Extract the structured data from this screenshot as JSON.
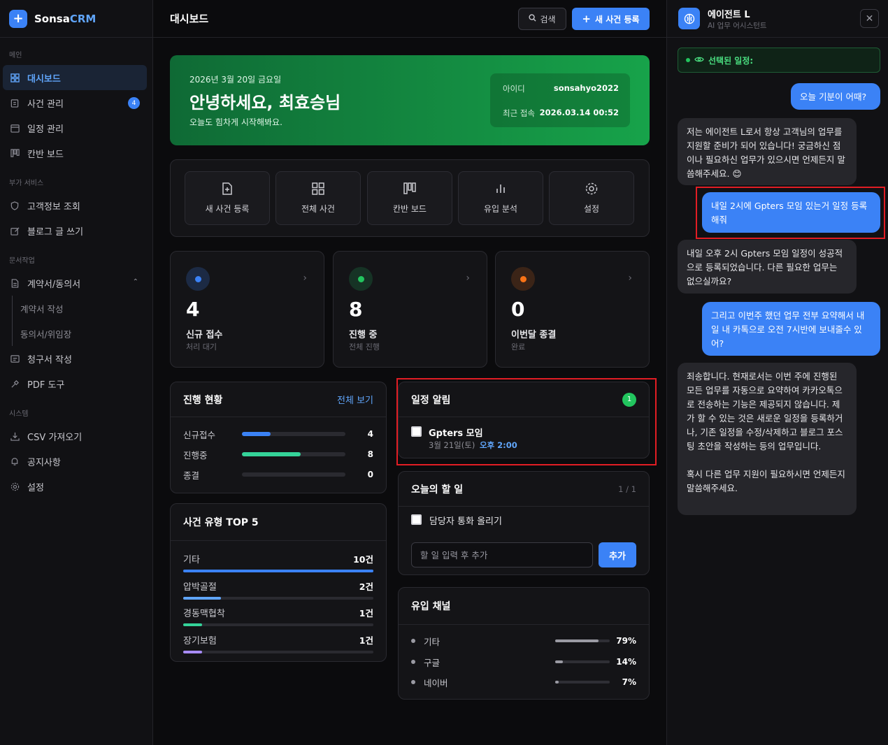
{
  "brand": {
    "name_main": "Sonsa",
    "name_accent": "CRM"
  },
  "sidebar": {
    "sections": {
      "main": "메인",
      "extra": "부가 서비스",
      "docs": "문서작업",
      "system": "시스템"
    },
    "items": [
      {
        "label": "대시보드",
        "icon": "grid-icon"
      },
      {
        "label": "사건 관리",
        "icon": "clipboard-icon",
        "badge": "4"
      },
      {
        "label": "일정 관리",
        "icon": "calendar-icon"
      },
      {
        "label": "칸반 보드",
        "icon": "kanban-icon"
      },
      {
        "label": "고객정보 조회",
        "icon": "shield-icon"
      },
      {
        "label": "블로그 글 쓰기",
        "icon": "edit-icon"
      },
      {
        "label": "계약서/동의서",
        "icon": "document-icon"
      },
      {
        "label": "계약서 작성"
      },
      {
        "label": "동의서/위임장"
      },
      {
        "label": "청구서 작성",
        "icon": "receipt-icon"
      },
      {
        "label": "PDF 도구",
        "icon": "tool-icon"
      },
      {
        "label": "CSV 가져오기",
        "icon": "download-icon"
      },
      {
        "label": "공지사항",
        "icon": "bell-icon"
      },
      {
        "label": "설정",
        "icon": "gear-icon"
      }
    ]
  },
  "header": {
    "title": "대시보드",
    "search_label": "검색",
    "new_case_label": "새 사건 등록"
  },
  "hero": {
    "date": "2026년 3월 20일 금요일",
    "greeting": "안녕하세요, 최효승님",
    "subtitle": "오늘도 힘차게 시작해봐요.",
    "id_label": "아이디",
    "id_value": "sonsahyo2022",
    "last_login_label": "최근 접속",
    "last_login_value": "2026.03.14 00:52"
  },
  "quick_actions": [
    {
      "label": "새 사건 등록",
      "icon": "file-plus-icon"
    },
    {
      "label": "전체 사건",
      "icon": "grid-icon"
    },
    {
      "label": "칸반 보드",
      "icon": "kanban-icon"
    },
    {
      "label": "유입 분석",
      "icon": "bar-chart-icon"
    },
    {
      "label": "설정",
      "icon": "gear-icon"
    }
  ],
  "stats": [
    {
      "value": "4",
      "label": "신규 접수",
      "sub": "처리 대기",
      "color": "#3b82f6",
      "bg": "#1c2a44"
    },
    {
      "value": "8",
      "label": "진행 중",
      "sub": "전체 진행",
      "color": "#22c55e",
      "bg": "#163325"
    },
    {
      "value": "0",
      "label": "이번달 종결",
      "sub": "완료",
      "color": "#f97316",
      "bg": "#3b2417"
    }
  ],
  "progress": {
    "title": "진행 현황",
    "link": "전체 보기",
    "rows": [
      {
        "label": "신규접수",
        "value": "4",
        "ratio": 0.28,
        "color": "#3b82f6"
      },
      {
        "label": "진행중",
        "value": "8",
        "ratio": 0.57,
        "color": "#34d399"
      },
      {
        "label": "종결",
        "value": "0",
        "ratio": 0,
        "color": "#6b6b74"
      }
    ]
  },
  "case_types": {
    "title": "사건 유형 TOP 5",
    "rows": [
      {
        "label": "기타",
        "value": "10건",
        "ratio": 1.0,
        "color": "#3b82f6"
      },
      {
        "label": "압박골절",
        "value": "2건",
        "ratio": 0.2,
        "color": "#60a5fa"
      },
      {
        "label": "경동맥협착",
        "value": "1건",
        "ratio": 0.1,
        "color": "#34d399"
      },
      {
        "label": "장기보험",
        "value": "1건",
        "ratio": 0.1,
        "color": "#a78bfa"
      }
    ]
  },
  "schedule_alert": {
    "title": "일정 알림",
    "count": "1",
    "item_title": "Gpters 모임",
    "item_date": "3월 21일(토)",
    "item_time": "오후 2:00"
  },
  "todo": {
    "title": "오늘의 할 일",
    "counter": "1 / 1",
    "item": "담당자 통화 올리기",
    "placeholder": "할 일 입력 후 추가",
    "add_label": "추가"
  },
  "channels": {
    "title": "유입 채널",
    "rows": [
      {
        "label": "기타",
        "value": "79%",
        "ratio": 0.79
      },
      {
        "label": "구글",
        "value": "14%",
        "ratio": 0.14
      },
      {
        "label": "네이버",
        "value": "7%",
        "ratio": 0.07
      }
    ]
  },
  "chat": {
    "agent_name": "에이전트 L",
    "agent_role": "AI 업무 어시스턴트",
    "selected_label": "선택된 일정:",
    "messages": [
      {
        "role": "user",
        "text": "오늘 기분이 어때?"
      },
      {
        "role": "bot",
        "text": "저는 에이전트 L로서 항상 고객님의 업무를 지원할 준비가 되어 있습니다! 궁금하신 점이나 필요하신 업무가 있으시면 언제든지 말씀해주세요. 😊"
      },
      {
        "role": "user",
        "text": "내일 2시에 Gpters 모임 있는거 일정 등록해줘"
      },
      {
        "role": "bot",
        "text": "내일 오후 2시 Gpters 모임 일정이 성공적으로 등록되었습니다. 다른 필요한 업무는 없으실까요?"
      },
      {
        "role": "user",
        "text": "그리고 이번주 했던 업무 전부 요약해서 내일 내 카톡으로 오전 7시반에 보내줄수 있어?"
      },
      {
        "role": "bot",
        "text": "죄송합니다. 현재로서는 이번 주에 진행된 모든 업무를 자동으로 요약하여 카카오톡으로 전송하는 기능은 제공되지 않습니다. 제가 할 수 있는 것은 새로운 일정을 등록하거나, 기존 일정을 수정/삭제하고 블로그 포스팅 초안을 작성하는 등의 업무입니다.\n\n혹시 다른 업무 지원이 필요하시면 언제든지 말씀해주세요."
      }
    ]
  },
  "colors": {
    "accent": "#3b82f6",
    "green": "#22c55e",
    "highlight": "#e11d24"
  }
}
